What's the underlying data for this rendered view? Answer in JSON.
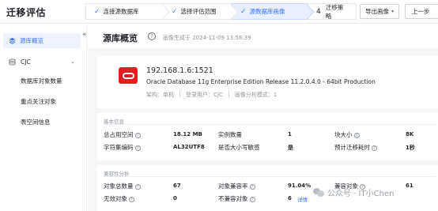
{
  "app": {
    "title": "迁移评估"
  },
  "steps": [
    {
      "label": "连接源数据库",
      "state": "done"
    },
    {
      "label": "选择评估范围",
      "state": "done"
    },
    {
      "label": "源数据库画像",
      "state": "active"
    },
    {
      "number": "4",
      "label": "迁移策略",
      "state": "pending"
    }
  ],
  "toolbar": {
    "export_label": "导出画像",
    "prev_label": "上一步"
  },
  "sidebar": {
    "active_item": "源库概览",
    "group": "CJC",
    "sub_items": [
      "数据库对象数量",
      "重点关注对象",
      "表空间信息"
    ]
  },
  "page": {
    "title": "源库概览",
    "generated": "画像生成于 2024-11-09 13:58:39"
  },
  "db": {
    "host": "192.168.1.6:1521",
    "version": "Oracle Database 11g Enterprise Edition Release 11.2.0.4.0 - 64bit Production",
    "arch": "架构：单机",
    "login_user": "登录用户：CJC",
    "analysis_mode": "画像分析模式：1"
  },
  "basic": {
    "title": "基本信息",
    "rows": [
      {
        "l1": "总占用空间",
        "v1": "18.12 MB",
        "l2": "实例数量",
        "v2": "1",
        "l3": "块大小",
        "v3": "8K"
      },
      {
        "l1": "字符集编码",
        "v1": "AL32UTF8",
        "l2": "是否大小写敏感",
        "v2": "是",
        "l3": "预计迁移耗时",
        "v3": "1秒"
      }
    ]
  },
  "compat": {
    "title": "兼容性分析",
    "rows": [
      {
        "l1": "对象总数量",
        "v1": "67",
        "l2": "对象兼容率",
        "v2": "91.04%",
        "l3": "兼容对象",
        "v3": "61"
      },
      {
        "l1": "无效对象",
        "v1": "0",
        "l2": "不兼容对象",
        "v2": "6",
        "link": "详情"
      }
    ]
  },
  "watermark": {
    "text": "公众号 · IT小Chen"
  },
  "colors": {
    "accent": "#3370ff",
    "oracle": "#e02020",
    "bg": "#f5f6f7"
  }
}
